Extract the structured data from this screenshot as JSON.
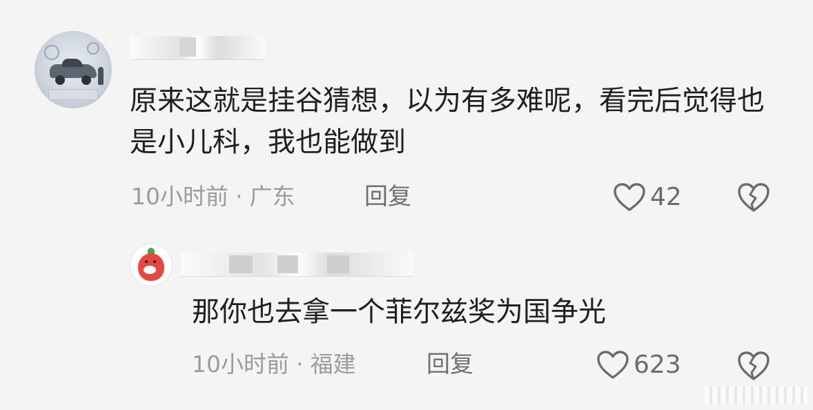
{
  "comments": [
    {
      "text": "原来这就是挂谷猜想，以为有多难呢，看完后觉得也是小儿科，我也能做到",
      "time": "10小时前",
      "separator": "·",
      "location": "广东",
      "reply_label": "回复",
      "likes": "42",
      "avatar_icon": "avatar-car-showroom",
      "like_icon": "heart-outline-icon",
      "dislike_icon": "broken-heart-icon"
    },
    {
      "text": "那你也去拿一个菲尔兹奖为国争光",
      "time": "10小时前",
      "separator": "·",
      "location": "福建",
      "reply_label": "回复",
      "likes": "623",
      "avatar_icon": "avatar-chili-cartoon",
      "like_icon": "heart-outline-icon",
      "dislike_icon": "broken-heart-icon"
    }
  ],
  "colors": {
    "background": "#f4f4f4",
    "text": "#1f1f1f",
    "meta": "#9b9b9b",
    "action": "#6b6b6b"
  }
}
